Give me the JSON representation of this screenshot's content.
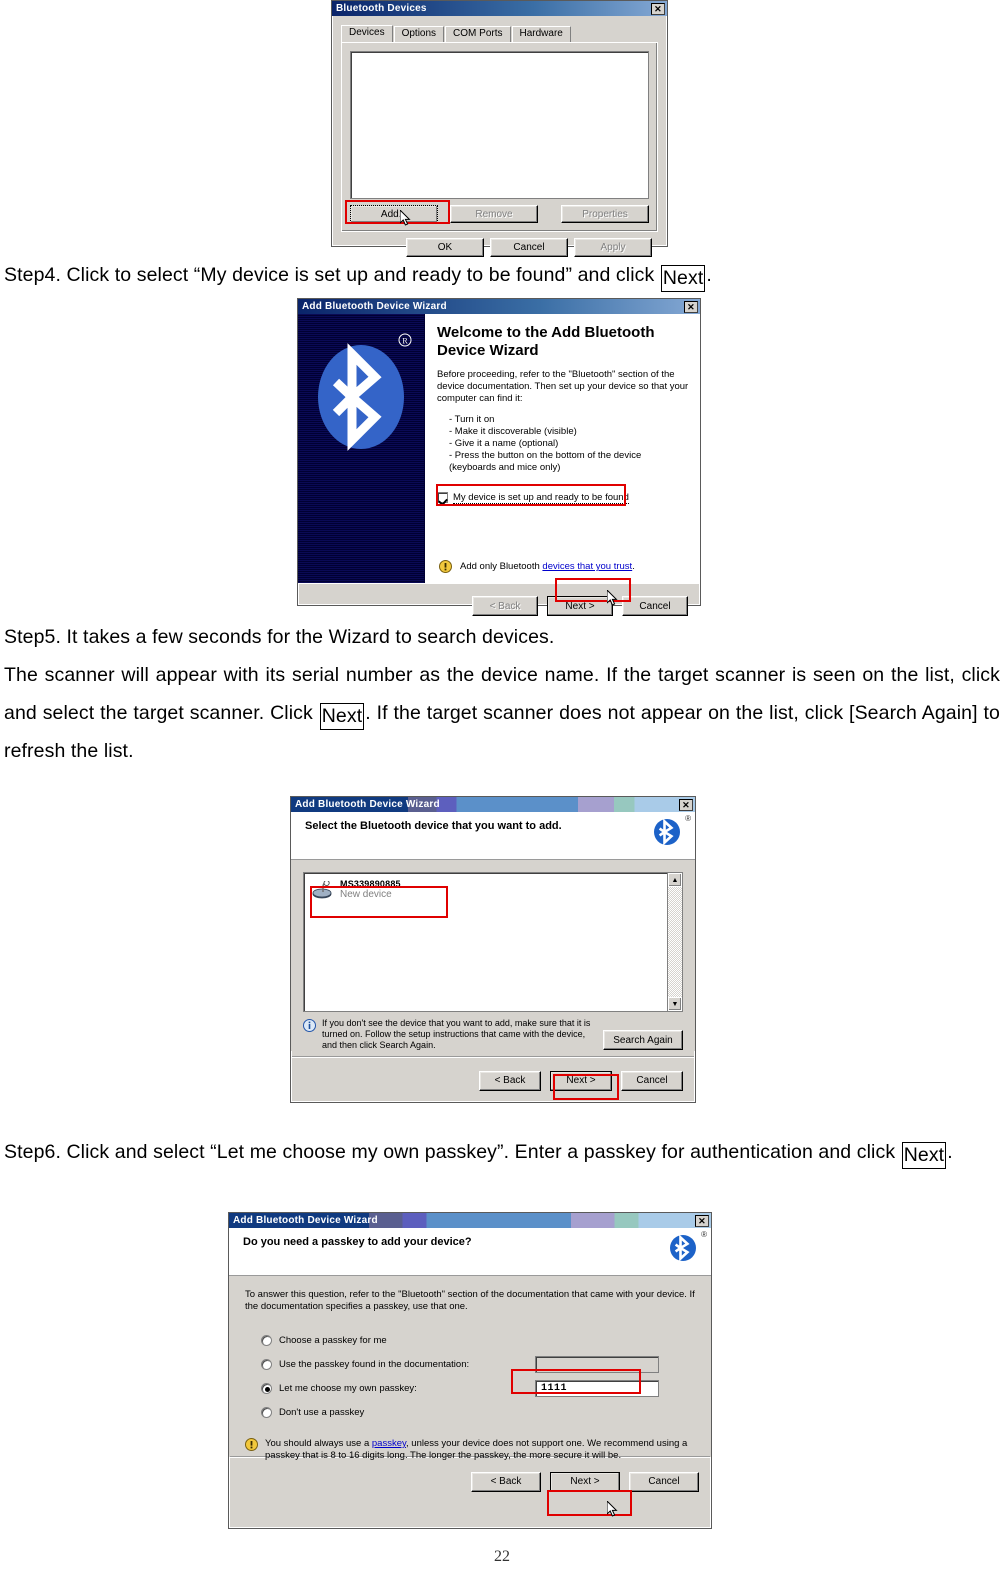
{
  "page": {
    "number": "22"
  },
  "steps": {
    "step4": {
      "prefix": "Step4. Click to select “My device is set up and ready to be found” and click ",
      "boxed": "Next",
      "suffix": "."
    },
    "step5": {
      "line1": "Step5. It takes a few seconds for the Wizard to search devices.",
      "line2a": "The scanner will appear with its serial number as the device name.    If the target scanner is seen on the list, click and select the target scanner.    Click ",
      "boxed": "Next",
      "line2b": ".    If the target scanner does not appear on the list, click [Search Again] to refresh the list."
    },
    "step6": {
      "prefix": "Step6. Click and select “Let me choose my own passkey”. Enter a passkey for authentication and click ",
      "boxed": "Next",
      "suffix": "."
    }
  },
  "dialog_bt_devices": {
    "title": "Bluetooth Devices",
    "close_label": "✕",
    "tabs": [
      {
        "label": "Devices",
        "active": true
      },
      {
        "label": "Options",
        "active": false
      },
      {
        "label": "COM Ports",
        "active": false
      },
      {
        "label": "Hardware",
        "active": false
      }
    ],
    "buttons": {
      "add": "Add...",
      "remove": "Remove",
      "properties": "Properties",
      "ok": "OK",
      "cancel": "Cancel",
      "apply": "Apply"
    }
  },
  "dialog_welcome": {
    "title": "Add Bluetooth Device Wizard",
    "close_label": "✕",
    "heading": "Welcome to the Add Bluetooth Device Wizard",
    "paragraph": "Before proceeding, refer to the \"Bluetooth\" section of the device documentation. Then set up your device so that your computer can find it:",
    "bullets": [
      "- Turn it on",
      "- Make it discoverable (visible)",
      "- Give it a name (optional)",
      "- Press the button on the bottom of the device",
      "  (keyboards and mice only)"
    ],
    "checkbox_label": "My device is set up and ready to be found",
    "checkbox_checked": true,
    "trust_text_prefix": "Add only Bluetooth ",
    "trust_link": "devices that you trust",
    "trust_text_suffix": ".",
    "buttons": {
      "back": "< Back",
      "next": "Next >",
      "cancel": "Cancel"
    },
    "registered_mark": "®"
  },
  "dialog_select_device": {
    "title": "Add Bluetooth Device Wizard",
    "close_label": "✕",
    "heading": "Select the Bluetooth device that you want to add.",
    "device": {
      "name": "MS339890885",
      "status": "New device"
    },
    "info_text": "If you don't see the device that you want to add, make sure that it is turned on. Follow the setup instructions that came with the device, and then click Search Again.",
    "search_again": "Search Again",
    "buttons": {
      "back": "< Back",
      "next": "Next >",
      "cancel": "Cancel"
    },
    "registered_mark": "®",
    "scroll_up": "▲",
    "scroll_down": "▼"
  },
  "dialog_passkey": {
    "title": "Add Bluetooth Device Wizard",
    "close_label": "✕",
    "heading": "Do you need a passkey to add your device?",
    "intro": "To answer this question, refer to the \"Bluetooth\" section of the documentation that came with your device. If the documentation specifies a passkey, use that one.",
    "options": [
      {
        "label": "Choose a passkey for me",
        "selected": false,
        "has_input": false,
        "value": ""
      },
      {
        "label": "Use the passkey found in the documentation:",
        "selected": false,
        "has_input": true,
        "value": ""
      },
      {
        "label": "Let me choose my own passkey:",
        "selected": true,
        "has_input": true,
        "value": "1111"
      },
      {
        "label": "Don't use a passkey",
        "selected": false,
        "has_input": false,
        "value": ""
      }
    ],
    "note_prefix": "You should always use a ",
    "note_link": "passkey",
    "note_suffix": ", unless your device does not support one. We recommend using a passkey that is 8 to 16 digits long. The longer the passkey, the more secure it will be.",
    "buttons": {
      "back": "< Back",
      "next": "Next >",
      "cancel": "Cancel"
    },
    "registered_mark": "®"
  },
  "colors": {
    "title_blue": "#0a246a",
    "dialog_face": "#d6d3ce",
    "highlight_red": "#e00000",
    "bluetooth_blue": "#2b5fc0"
  }
}
